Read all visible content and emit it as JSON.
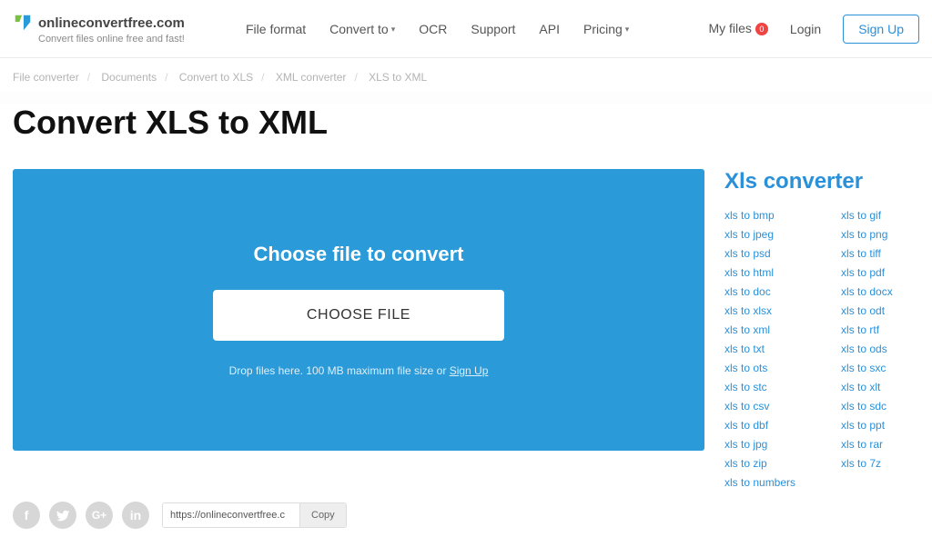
{
  "header": {
    "brand_name": "onlineconvertfree.com",
    "tagline": "Convert files online free and fast!",
    "nav": {
      "file_format": "File format",
      "convert_to": "Convert to",
      "ocr": "OCR",
      "support": "Support",
      "api": "API",
      "pricing": "Pricing"
    },
    "right": {
      "my_files": "My files",
      "my_files_count": "0",
      "login": "Login",
      "signup": "Sign Up"
    }
  },
  "breadcrumbs": {
    "file_converter": "File converter",
    "documents": "Documents",
    "convert_to_xls": "Convert to XLS",
    "xml_converter": "XML converter",
    "xls_to_xml": "XLS to XML"
  },
  "page": {
    "title": "Convert XLS to XML"
  },
  "dropzone": {
    "heading": "Choose file to convert",
    "button": "CHOOSE FILE",
    "sub_prefix": "Drop files here. 100 MB maximum file size or ",
    "sub_link": "Sign Up"
  },
  "sidebar": {
    "title": "Xls converter",
    "col1": [
      "xls to bmp",
      "xls to jpeg",
      "xls to psd",
      "xls to html",
      "xls to doc",
      "xls to xlsx",
      "xls to xml",
      "xls to txt",
      "xls to ots",
      "xls to stc",
      "xls to csv",
      "xls to dbf",
      "xls to jpg",
      "xls to zip",
      "xls to numbers"
    ],
    "col2": [
      "xls to gif",
      "xls to png",
      "xls to tiff",
      "xls to pdf",
      "xls to docx",
      "xls to odt",
      "xls to rtf",
      "xls to ods",
      "xls to sxc",
      "xls to xlt",
      "xls to sdc",
      "xls to ppt",
      "xls to rar",
      "xls to 7z"
    ]
  },
  "share": {
    "url": "https://onlineconvertfree.c",
    "copy": "Copy"
  }
}
